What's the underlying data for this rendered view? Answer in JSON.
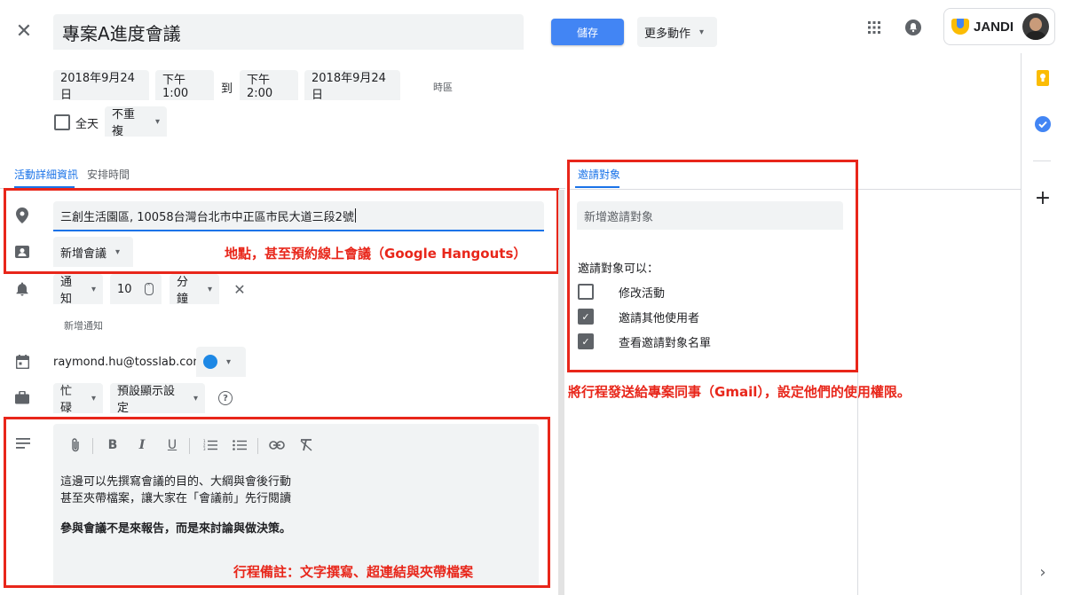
{
  "header": {
    "title": "專案A進度會議",
    "save_label": "儲存",
    "more_actions_label": "更多動作",
    "brand": "JANDI"
  },
  "datetime": {
    "start_date": "2018年9月24日",
    "start_time": "下午1:00",
    "to_label": "到",
    "end_time": "下午2:00",
    "end_date": "2018年9月24日",
    "timezone_label": "時區",
    "all_day_label": "全天",
    "repeat_label": "不重複"
  },
  "tabs": {
    "details": "活動詳細資訊",
    "schedule": "安排時間",
    "guests": "邀請對象"
  },
  "details": {
    "location": "三創生活園區, 10058台灣台北市中正區市民大道三段2號",
    "conference_label": "新增會議",
    "notify_label": "通知",
    "notify_value": "10",
    "notify_unit": "分鐘",
    "add_notification": "新增通知",
    "calendar_owner": "raymond.hu@tosslab.com",
    "calendar_color": "#1e88e5",
    "busy_label": "忙碌",
    "visibility_label": "預設顯示設定"
  },
  "description": {
    "line1": "這邊可以先撰寫會議的目的、大綱與會後行動",
    "line2": "甚至夾帶檔案，讓大家在「會議前」先行閱讀",
    "line3": "參與會議不是來報告，而是來討論與做決策。"
  },
  "guests": {
    "add_placeholder": "新增邀請對象",
    "permissions_title": "邀請對象可以：",
    "permissions": [
      {
        "label": "修改活動",
        "checked": false
      },
      {
        "label": "邀請其他使用者",
        "checked": true
      },
      {
        "label": "查看邀請對象名單",
        "checked": true
      }
    ]
  },
  "annotations": {
    "location_note": "地點，甚至預約線上會議（Google Hangouts）",
    "guests_note": "將行程發送給專案同事（Gmail），設定他們的使用權限。",
    "description_note": "行程備註：文字撰寫、超連結與夾帶檔案"
  },
  "colors": {
    "accent": "#1a73e8",
    "save_button": "#4285f4",
    "annotation_red": "#e8261a"
  }
}
